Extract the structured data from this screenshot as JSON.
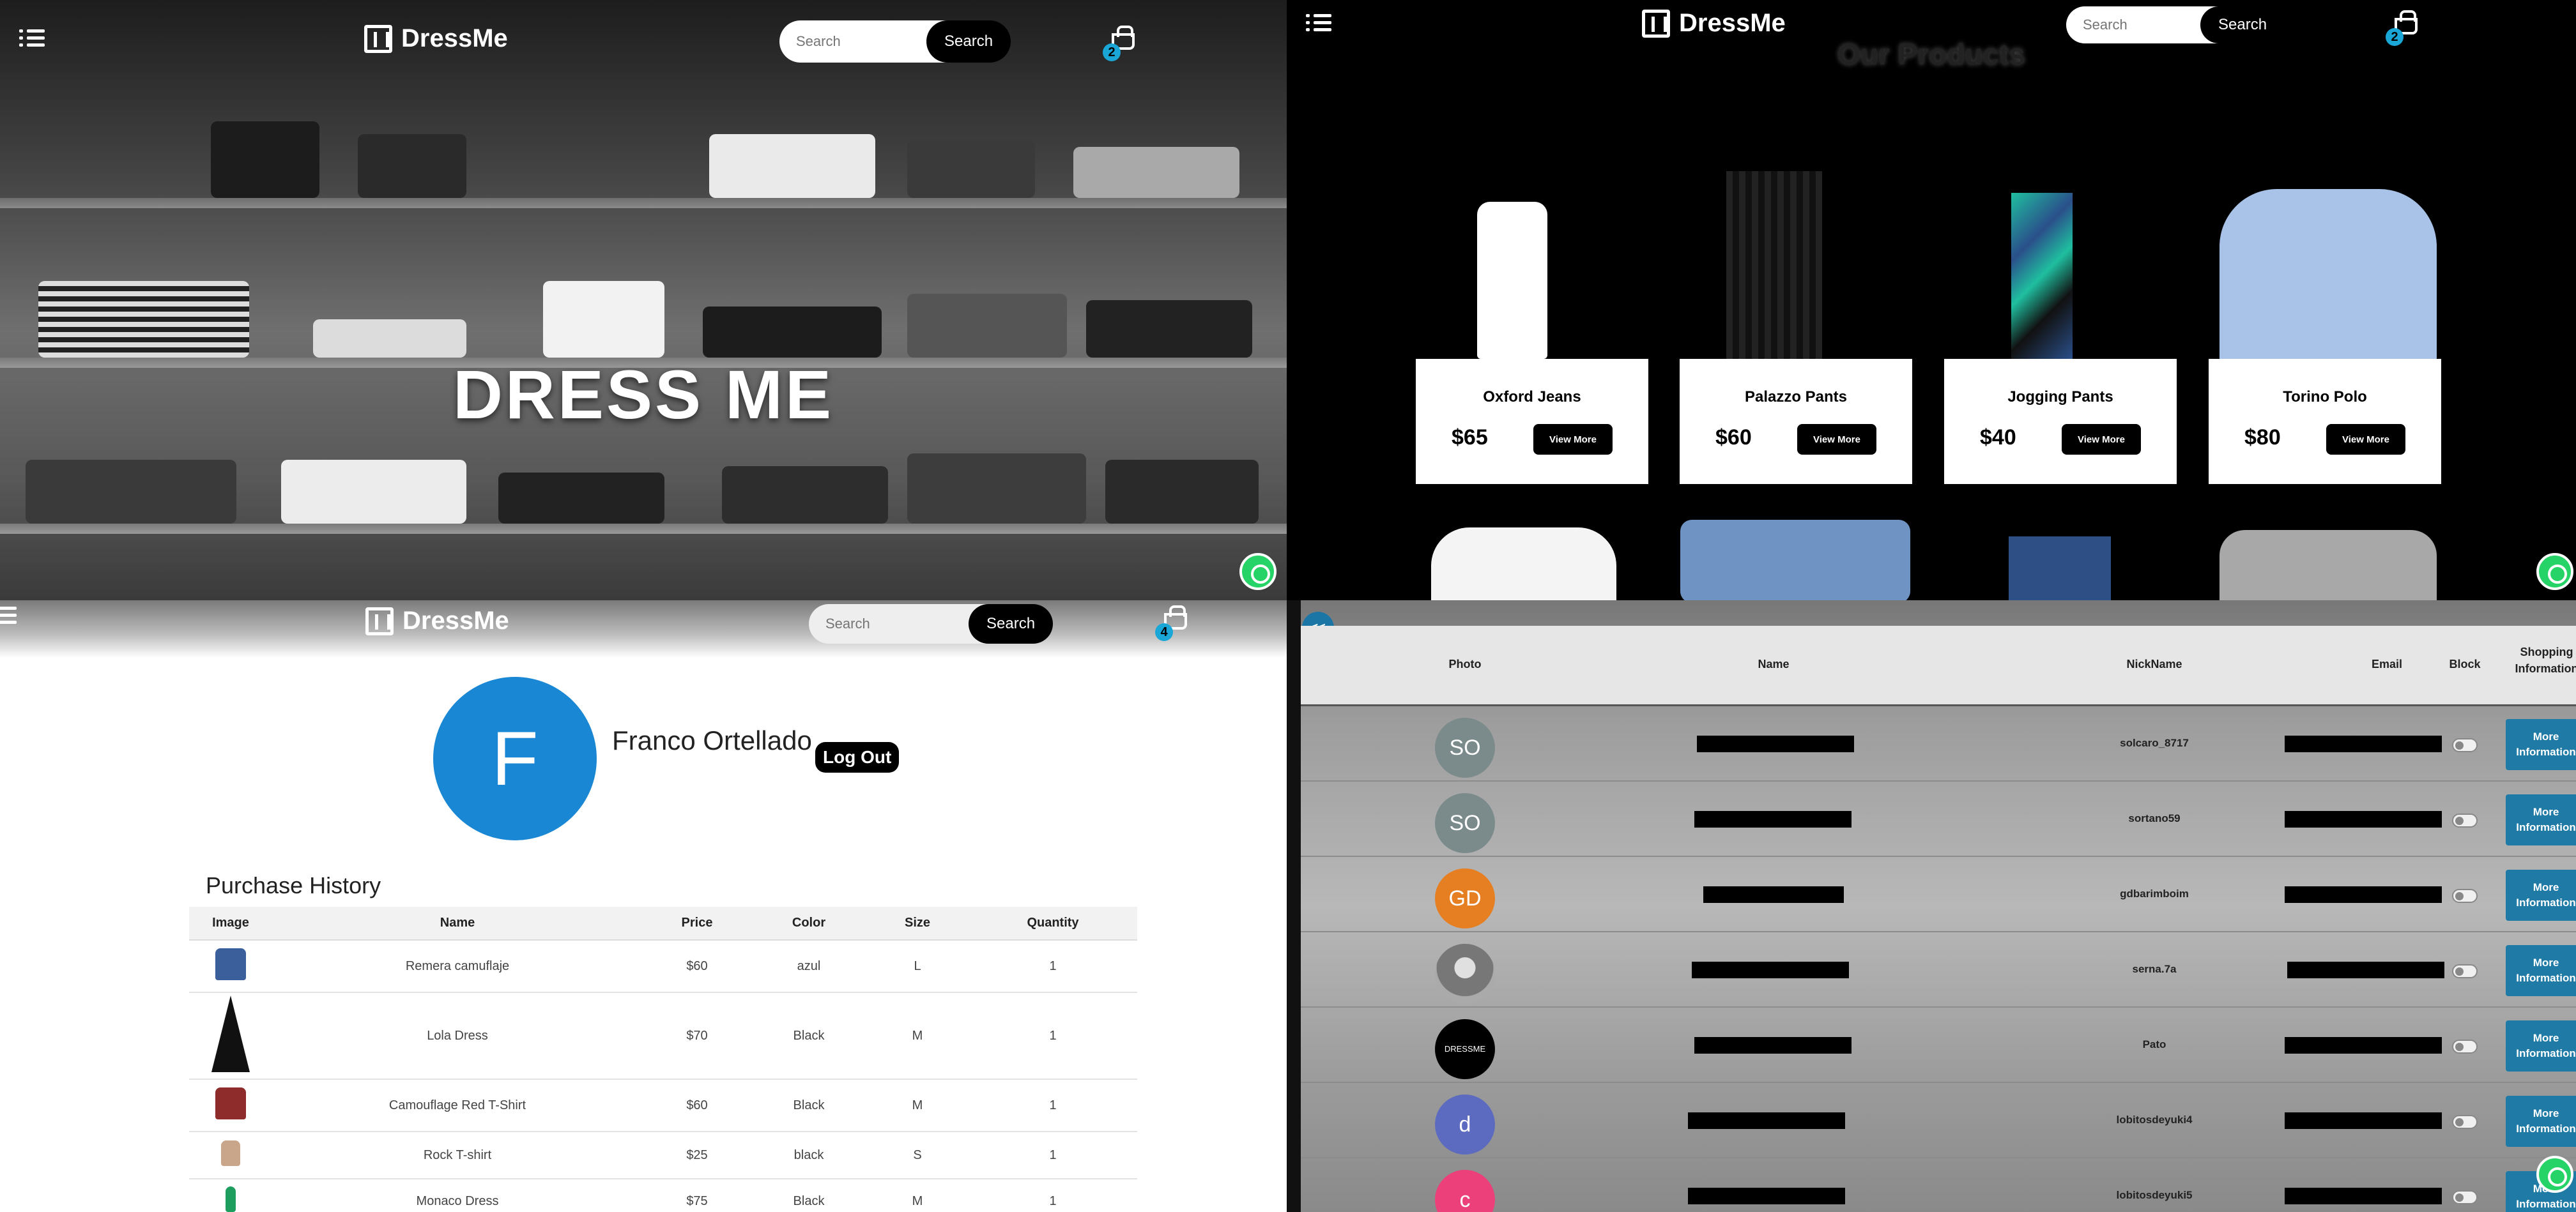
{
  "nav": {
    "brand": "DressMe",
    "search_placeholder": "Search",
    "search_button": "Search"
  },
  "home": {
    "hero_title": "DRESS ME",
    "cart_count": "2"
  },
  "products": {
    "title": "Our Products",
    "cart_count": "2",
    "items": [
      {
        "name": "Oxford Jeans",
        "price": "$65",
        "button": "View More"
      },
      {
        "name": "Palazzo Pants",
        "price": "$60",
        "button": "View More"
      },
      {
        "name": "Jogging Pants",
        "price": "$40",
        "button": "View More"
      },
      {
        "name": "Torino Polo",
        "price": "$80",
        "button": "View More"
      }
    ]
  },
  "profile": {
    "cart_count": "4",
    "avatar_letter": "F",
    "name": "Franco Ortellado",
    "logout": "Log Out",
    "purchase_history_title": "Purchase History",
    "columns": [
      "Image",
      "Name",
      "Price",
      "Color",
      "Size",
      "Quantity"
    ],
    "rows": [
      {
        "name": "Remera camuflaje",
        "price": "$60",
        "color": "azul",
        "size": "L",
        "quantity": "1"
      },
      {
        "name": "Lola Dress",
        "price": "$70",
        "color": "Black",
        "size": "M",
        "quantity": "1"
      },
      {
        "name": "Camouflage Red T-Shirt",
        "price": "$60",
        "color": "Black",
        "size": "M",
        "quantity": "1"
      },
      {
        "name": "Rock T-shirt",
        "price": "$25",
        "color": "black",
        "size": "S",
        "quantity": "1"
      },
      {
        "name": "Monaco Dress",
        "price": "$75",
        "color": "Black",
        "size": "M",
        "quantity": "1"
      }
    ]
  },
  "admin": {
    "back_button": "<<",
    "columns": {
      "photo": "Photo",
      "name": "Name",
      "nickname": "NickName",
      "email": "Email",
      "block": "Block",
      "shopping": "Shopping Information"
    },
    "more_button": "More Information",
    "rows": [
      {
        "initials": "SO",
        "nickname": "solcaro_8717",
        "color": "#7b8a8a"
      },
      {
        "initials": "SO",
        "nickname": "sortano59",
        "color": "#7b8a8a"
      },
      {
        "initials": "GD",
        "nickname": "gdbarimboim",
        "color": "#e67e22"
      },
      {
        "initials": "",
        "nickname": "serna.7a",
        "color": "#9a9a9a"
      },
      {
        "initials": "DRESSME",
        "nickname": "Pato",
        "color": "#000000"
      },
      {
        "initials": "d",
        "nickname": "lobitosdeyuki4",
        "color": "#5c6bc0"
      },
      {
        "initials": "c",
        "nickname": "lobitosdeyuki5",
        "color": "#ec407a"
      }
    ]
  },
  "colors": {
    "accent_blue": "#1aa7d8",
    "avatar_blue": "#1a87d5",
    "admin_button": "#1f7aa6",
    "whatsapp": "#25d366"
  }
}
